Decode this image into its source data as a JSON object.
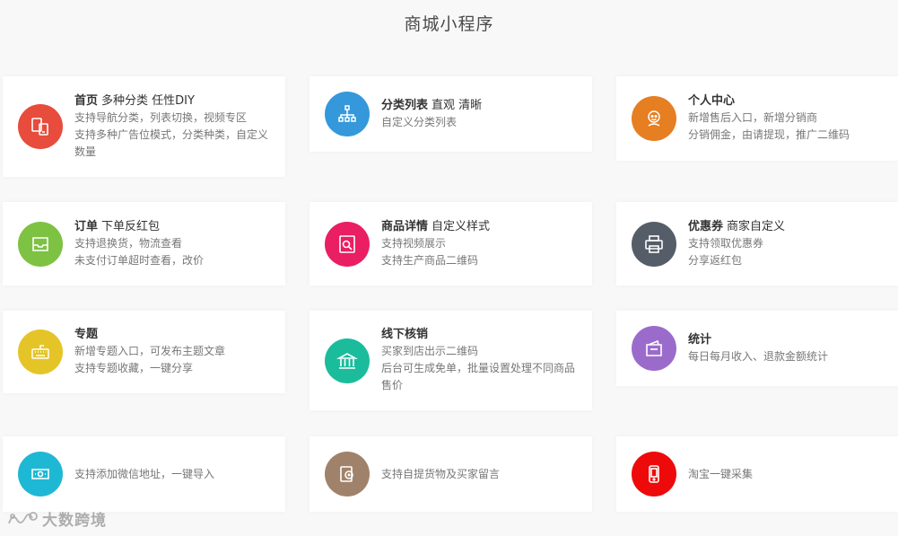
{
  "page": {
    "title": "商城小程序"
  },
  "cards": {
    "home": {
      "bold": "首页",
      "subtitle": "多种分类 任性DIY",
      "lines": [
        "支持导航分类，列表切换，视频专区",
        "支持多种广告位模式，分类种类，自定义",
        "数量"
      ],
      "color": "#e74c3c",
      "icon": "devices-icon"
    },
    "category": {
      "bold": "分类列表",
      "subtitle": "直观 清晰",
      "lines": [
        "自定义分类列表"
      ],
      "color": "#3498db",
      "icon": "hierarchy-icon"
    },
    "profile": {
      "bold": "个人中心",
      "subtitle": "",
      "lines": [
        "新增售后入口，新增分销商",
        "分销佣金，由请提现，推广二维码"
      ],
      "color": "#e67e22",
      "icon": "user-icon"
    },
    "order": {
      "bold": "订单",
      "subtitle": "下单反红包",
      "lines": [
        "支持退换货，物流查看",
        "未支付订单超时查看，改价"
      ],
      "color": "#7dc242",
      "icon": "tray-icon"
    },
    "product": {
      "bold": "商品详情",
      "subtitle": "自定义样式",
      "lines": [
        "支持视频展示",
        "支持生产商品二维码"
      ],
      "color": "#e91e63",
      "icon": "search-doc-icon"
    },
    "coupon": {
      "bold": "优惠券",
      "subtitle": "商家自定义",
      "lines": [
        "支持领取优惠券",
        "分享返红包"
      ],
      "color": "#555d68",
      "icon": "printer-icon"
    },
    "topic": {
      "bold": "专题",
      "subtitle": "",
      "lines": [
        "新增专题入口，可发布主题文章",
        "支持专题收藏，一键分享"
      ],
      "color": "#e5c428",
      "icon": "keyboard-icon"
    },
    "offline": {
      "bold": "线下核销",
      "subtitle": "",
      "lines": [
        "买家到店出示二维码",
        "后台可生成免单，批量设置处理不同商品",
        "售价"
      ],
      "color": "#1abc9c",
      "icon": "bank-icon"
    },
    "stats": {
      "bold": "统计",
      "subtitle": "",
      "lines": [
        "每日每月收入、退款金额统计"
      ],
      "color": "#9b6bcc",
      "icon": "wallet-icon"
    },
    "wechat_address": {
      "bold": "",
      "subtitle": "",
      "lines": [
        "支持添加微信地址，一键导入"
      ],
      "color": "#1fb8d4",
      "icon": "cash-icon"
    },
    "pickup": {
      "bold": "",
      "subtitle": "",
      "lines": [
        "支持自提货物及买家留言"
      ],
      "color": "#a0826a",
      "icon": "pickup-icon"
    },
    "taobao": {
      "bold": "",
      "subtitle": "",
      "lines": [
        "淘宝一键采集"
      ],
      "color": "#ee0a0a",
      "icon": "phone-icon"
    }
  },
  "watermark": {
    "text": "大数跨境"
  }
}
